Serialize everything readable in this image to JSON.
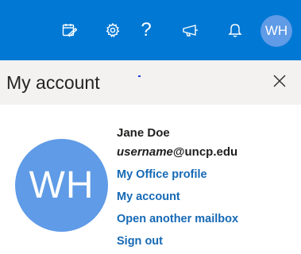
{
  "topbar": {
    "background": "#0078d4",
    "icons": [
      "my-day-icon",
      "gear-icon",
      "help-icon",
      "megaphone-icon",
      "bell-icon"
    ],
    "help_glyph": "?",
    "avatar_initials": "WH",
    "avatar_color": "#5f9be6"
  },
  "panel": {
    "title": "My account",
    "close_icon": "close-icon",
    "header_background": "#f3f2f1"
  },
  "profile": {
    "avatar_initials": "WH",
    "name": "Jane Doe",
    "email_user": "username",
    "email_domain": "@uncp.edu",
    "links": {
      "office_profile": "My Office profile",
      "my_account": "My account",
      "open_mailbox": "Open another mailbox",
      "sign_out": "Sign out"
    },
    "link_color": "#1669b5"
  }
}
